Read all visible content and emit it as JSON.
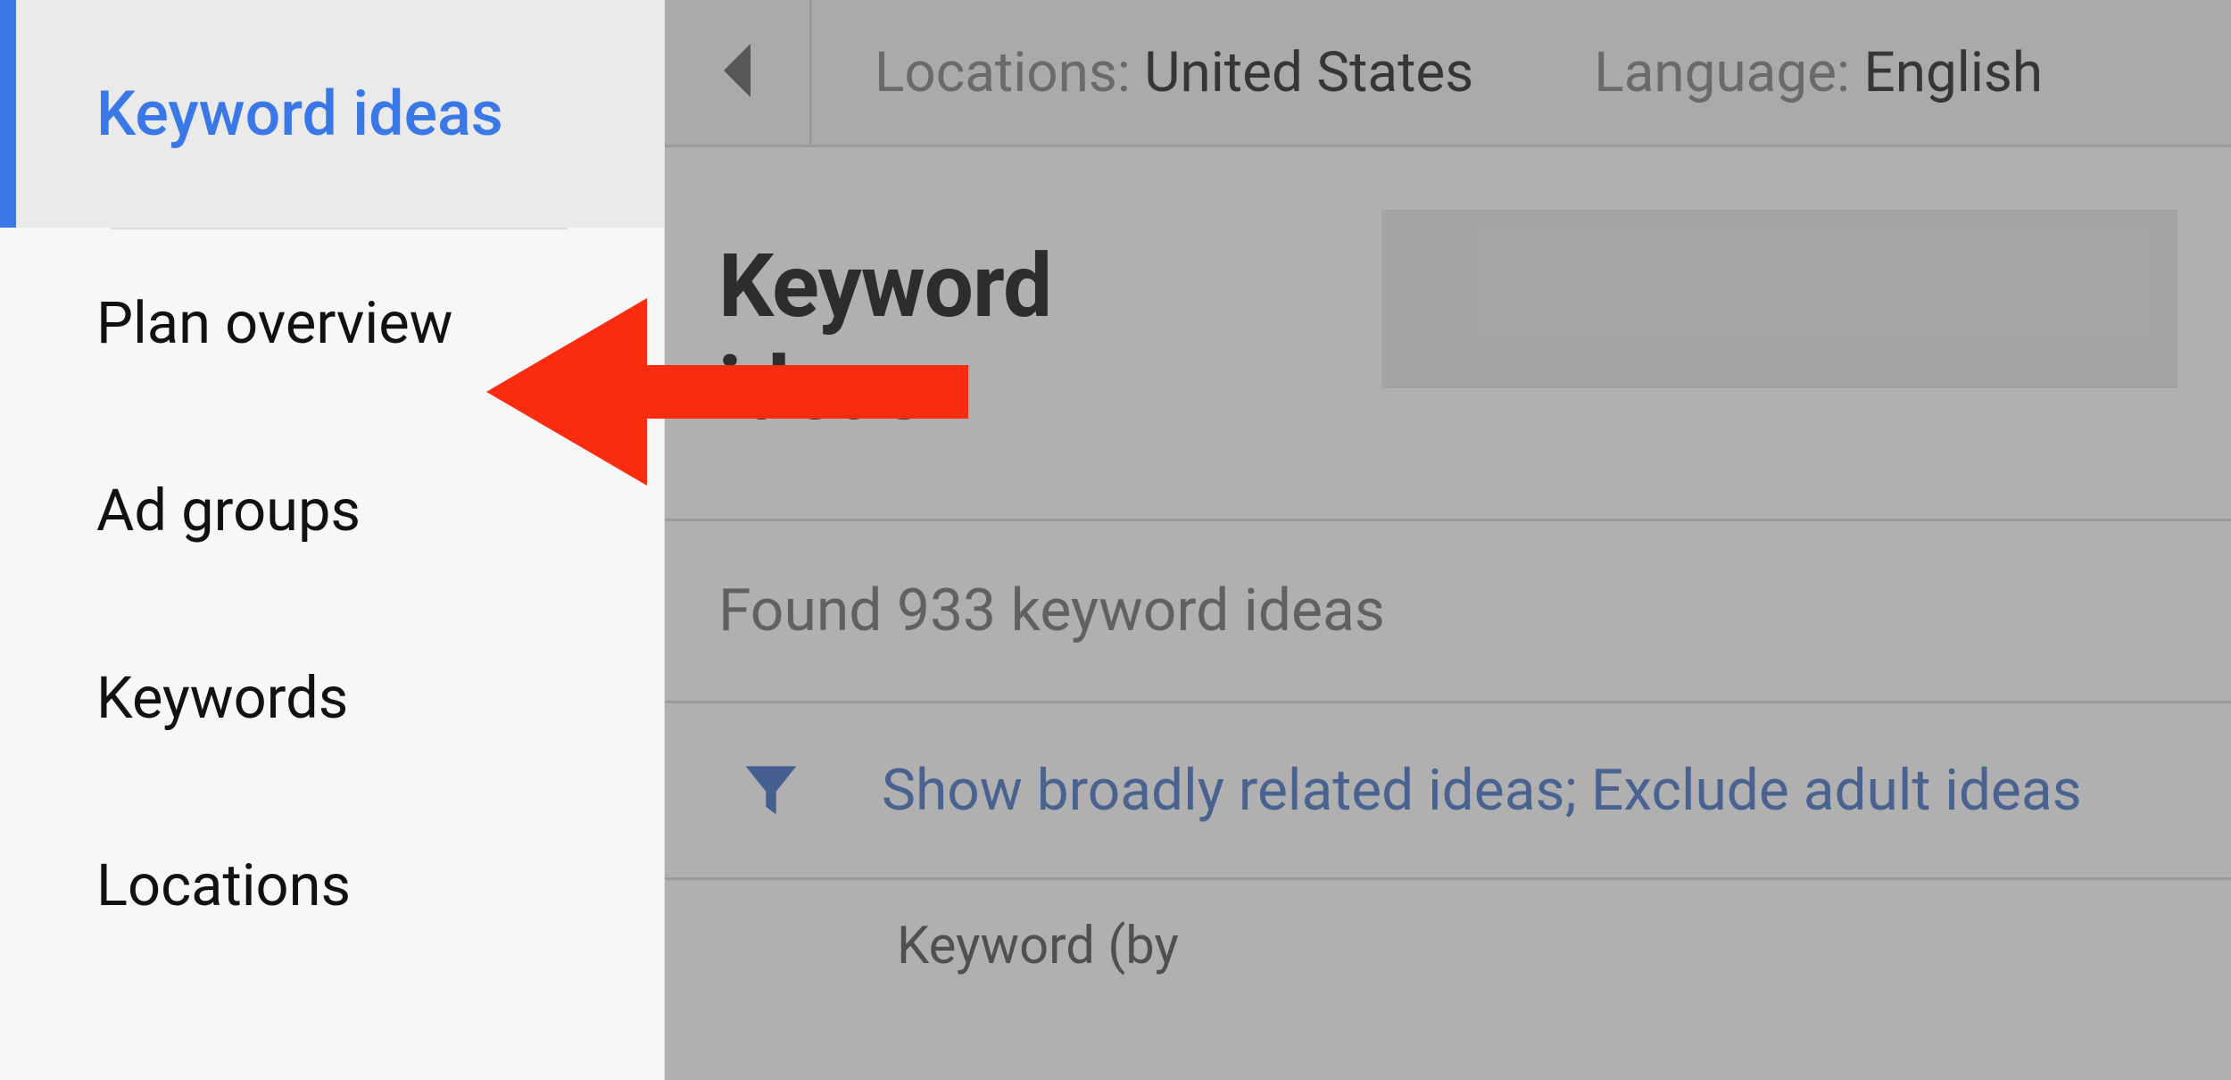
{
  "sidebar": {
    "items": [
      {
        "label": "Keyword ideas"
      },
      {
        "label": "Plan overview"
      },
      {
        "label": "Ad groups"
      },
      {
        "label": "Keywords"
      },
      {
        "label": "Locations"
      }
    ]
  },
  "toolbar": {
    "locations_label": "Locations: ",
    "locations_value": "United States",
    "language_label": "Language: ",
    "language_value": "English"
  },
  "page": {
    "title": "Keyword ideas",
    "found_text": "Found 933 keyword ideas",
    "filter_text": "Show broadly related ideas; Exclude adult ideas",
    "table_header": "Keyword (by"
  },
  "colors": {
    "accent": "#3b78e7",
    "arrow": "#fb2c0f",
    "link": "#4472c4"
  }
}
